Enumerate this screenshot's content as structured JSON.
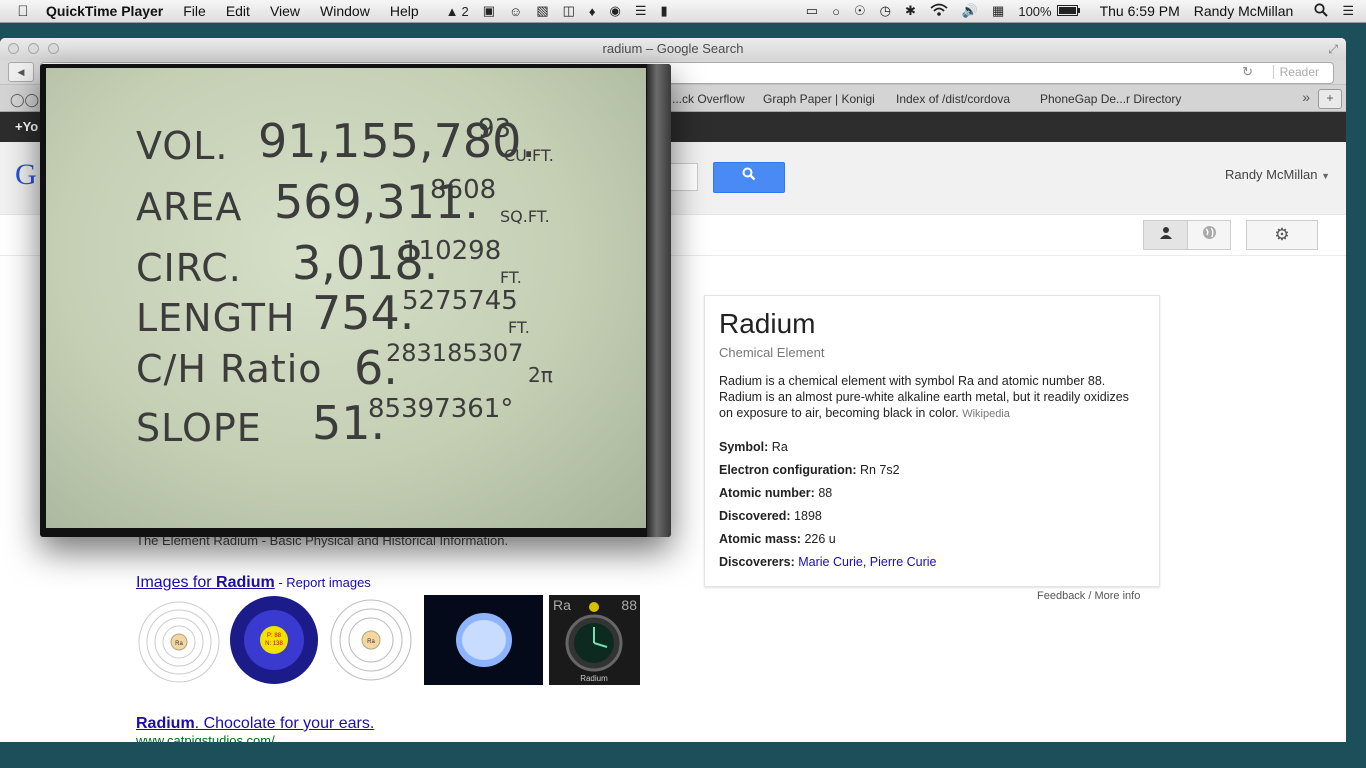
{
  "menubar": {
    "app_name": "QuickTime Player",
    "menus": [
      "File",
      "Edit",
      "View",
      "Window",
      "Help"
    ],
    "adobe_count": "2",
    "battery": "100%",
    "clock": "Thu 6:59 PM",
    "user": "Randy McMillan"
  },
  "browser": {
    "window_title": "radium – Google Search",
    "reader_label": "Reader",
    "bookmarks": [
      "...ck Overflow",
      "Graph Paper | Konigi",
      "Index of /dist/cordova",
      "PhoneGap De...r Directory"
    ]
  },
  "google": {
    "bar_item": "+Yo",
    "logo_letter": "G",
    "user_name": "Randy McMillan"
  },
  "video": {
    "rows": [
      {
        "label": "VOL.",
        "integer": "91,155,780.",
        "decimal": "93",
        "unit": "CU.FT."
      },
      {
        "label": "AREA",
        "integer": "569,311.",
        "decimal": "8608",
        "unit": "SQ.FT."
      },
      {
        "label": "CIRC.",
        "integer": "3,018.",
        "decimal": "110298",
        "unit": "FT."
      },
      {
        "label": "LENGTH",
        "integer": "754.",
        "decimal": "5275745",
        "unit": "FT."
      },
      {
        "label": "C/H Ratio",
        "integer": "6.",
        "decimal": "283185307",
        "unit": "2π"
      },
      {
        "label": "SLOPE",
        "integer": "51.",
        "decimal": "85397361°",
        "unit": ""
      }
    ]
  },
  "results": {
    "snippet": "The Element Radium - Basic Physical and Historical Information.",
    "images_prefix": "Images for ",
    "images_query": "Radium",
    "report_images": " - Report images",
    "thumb_labels": {
      "ra": "Ra",
      "p88": "P: 88",
      "n138": "N: 138",
      "symbol": "Ra",
      "number": "88",
      "caption": "Radium"
    },
    "second_title_bold": "Radium",
    "second_title_rest": ". Chocolate for your ears.",
    "second_url": "www.catpigstudios.com/"
  },
  "knowledge_panel": {
    "title": "Radium",
    "subtitle": "Chemical Element",
    "description": "Radium is a chemical element with symbol Ra and atomic number 88. Radium is an almost pure-white alkaline earth metal, but it readily oxidizes on exposure to air, becoming black in color.",
    "source": "Wikipedia",
    "facts": [
      {
        "label": "Symbol:",
        "value": "Ra"
      },
      {
        "label": "Electron configuration:",
        "value": "Rn 7s2"
      },
      {
        "label": "Atomic number:",
        "value": "88"
      },
      {
        "label": "Discovered:",
        "value": "1898"
      },
      {
        "label": "Atomic mass:",
        "value": "226 u"
      }
    ],
    "discoverers_label": "Discoverers:",
    "discoverers": [
      "Marie Curie",
      "Pierre Curie"
    ],
    "feedback": "Feedback / More info"
  },
  "icons": [
    "apple-icon",
    "search-icon",
    "gear-icon",
    "person-icon",
    "globe-icon",
    "wifi-icon",
    "volume-icon",
    "battery-icon",
    "spotlight-icon",
    "list-icon"
  ]
}
